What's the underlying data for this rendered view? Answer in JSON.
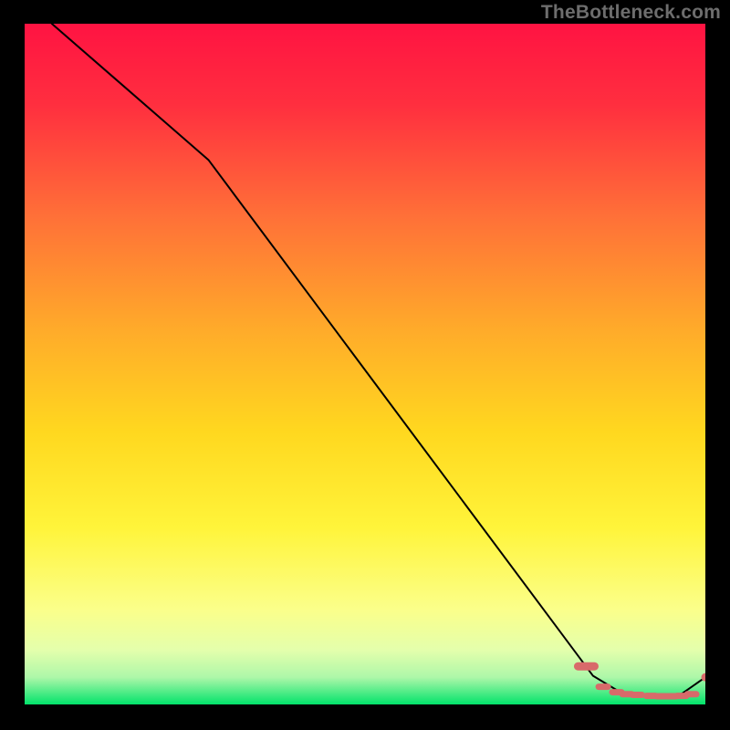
{
  "attribution": "TheBottleneck.com",
  "colors": {
    "page_bg": "#000000",
    "grad_top": "#ff1846",
    "grad_upper": "#ff7a35",
    "grad_mid": "#ffd921",
    "grad_low": "#faff70",
    "grad_lower": "#c8ffb0",
    "grad_bottom": "#00e56a",
    "line_black": "#000000",
    "marker": "#d86a6a"
  },
  "chart_data": {
    "type": "line",
    "title": "",
    "xlabel": "",
    "ylabel": "",
    "xlim": [
      0,
      100
    ],
    "ylim": [
      0,
      100
    ],
    "series": [
      {
        "name": "main-curve",
        "style": "solid",
        "x": [
          4,
          27,
          83.5,
          88,
          92,
          96,
          100
        ],
        "y": [
          100,
          80,
          4.2,
          1.5,
          1.2,
          1.2,
          4
        ]
      },
      {
        "name": "marker-dashes",
        "style": "dashed-markers",
        "x": [
          82.5,
          85,
          87,
          88.5,
          90,
          92,
          93.5,
          95,
          96.5,
          98
        ],
        "y": [
          5.6,
          2.6,
          1.8,
          1.5,
          1.4,
          1.25,
          1.2,
          1.2,
          1.25,
          1.5
        ]
      },
      {
        "name": "end-dot",
        "style": "dot",
        "x": [
          100
        ],
        "y": [
          4
        ]
      }
    ]
  }
}
